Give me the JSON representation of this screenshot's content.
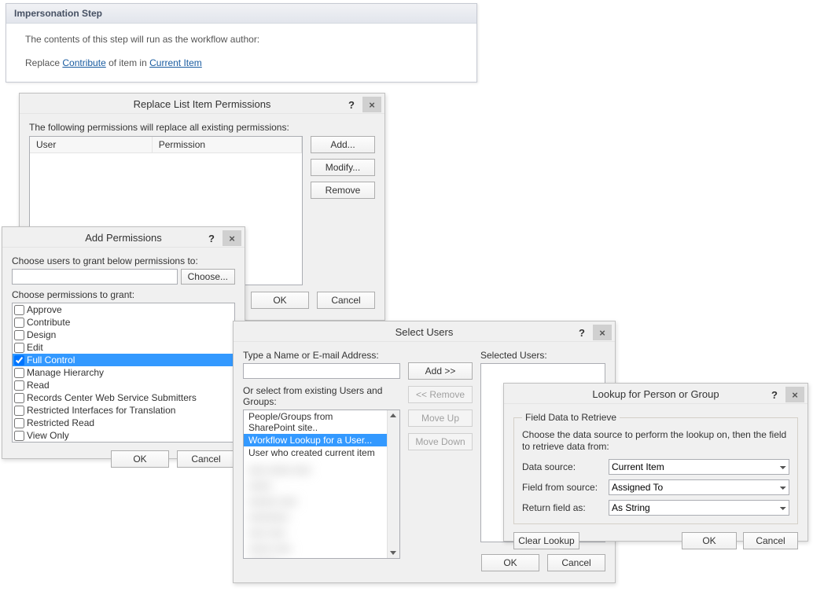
{
  "impersonation": {
    "title": "Impersonation Step",
    "line1": "The contents of this step will run as the workflow author:",
    "replace_pre": "Replace ",
    "link1": "Contribute",
    "mid": " of item in ",
    "link2": "Current Item"
  },
  "replacePerm": {
    "title": "Replace List Item Permissions",
    "prompt": "The following permissions will replace all existing permissions:",
    "col_user": "User",
    "col_perm": "Permission",
    "add": "Add...",
    "modify": "Modify...",
    "remove": "Remove",
    "ok": "OK",
    "cancel": "Cancel"
  },
  "addPerm": {
    "title": "Add Permissions",
    "users_label": "Choose users to grant below permissions to:",
    "choose": "Choose...",
    "perms_label": "Choose permissions to grant:",
    "items": [
      {
        "label": "Approve",
        "checked": false,
        "sel": false
      },
      {
        "label": "Contribute",
        "checked": false,
        "sel": false
      },
      {
        "label": "Design",
        "checked": false,
        "sel": false
      },
      {
        "label": "Edit",
        "checked": false,
        "sel": false
      },
      {
        "label": "Full Control",
        "checked": true,
        "sel": true
      },
      {
        "label": "Manage Hierarchy",
        "checked": false,
        "sel": false
      },
      {
        "label": "Read",
        "checked": false,
        "sel": false
      },
      {
        "label": "Records Center Web Service Submitters",
        "checked": false,
        "sel": false
      },
      {
        "label": "Restricted Interfaces for Translation",
        "checked": false,
        "sel": false
      },
      {
        "label": "Restricted Read",
        "checked": false,
        "sel": false
      },
      {
        "label": "View Only",
        "checked": false,
        "sel": false
      }
    ],
    "ok": "OK",
    "cancel": "Cancel"
  },
  "selectUsers": {
    "title": "Select Users",
    "type_label": "Type a Name or E-mail Address:",
    "selected_label": "Selected Users:",
    "add": "Add >>",
    "remove": "<< Remove",
    "moveup": "Move Up",
    "movedown": "Move Down",
    "or_label": "Or select from existing Users and Groups:",
    "list": [
      {
        "label": "People/Groups from SharePoint site..",
        "sel": false
      },
      {
        "label": "Workflow Lookup for a User...",
        "sel": true
      },
      {
        "label": "User who created current item",
        "sel": false
      }
    ],
    "ok": "OK",
    "cancel": "Cancel"
  },
  "lookup": {
    "title": "Lookup for Person or Group",
    "legend": "Field Data to Retrieve",
    "prompt": "Choose the data source to perform the lookup on, then the field to retrieve data from:",
    "ds_label": "Data source:",
    "ds_value": "Current Item",
    "ff_label": "Field from source:",
    "ff_value": "Assigned To",
    "rf_label": "Return field as:",
    "rf_value": "As String",
    "clear": "Clear Lookup",
    "ok": "OK",
    "cancel": "Cancel"
  }
}
